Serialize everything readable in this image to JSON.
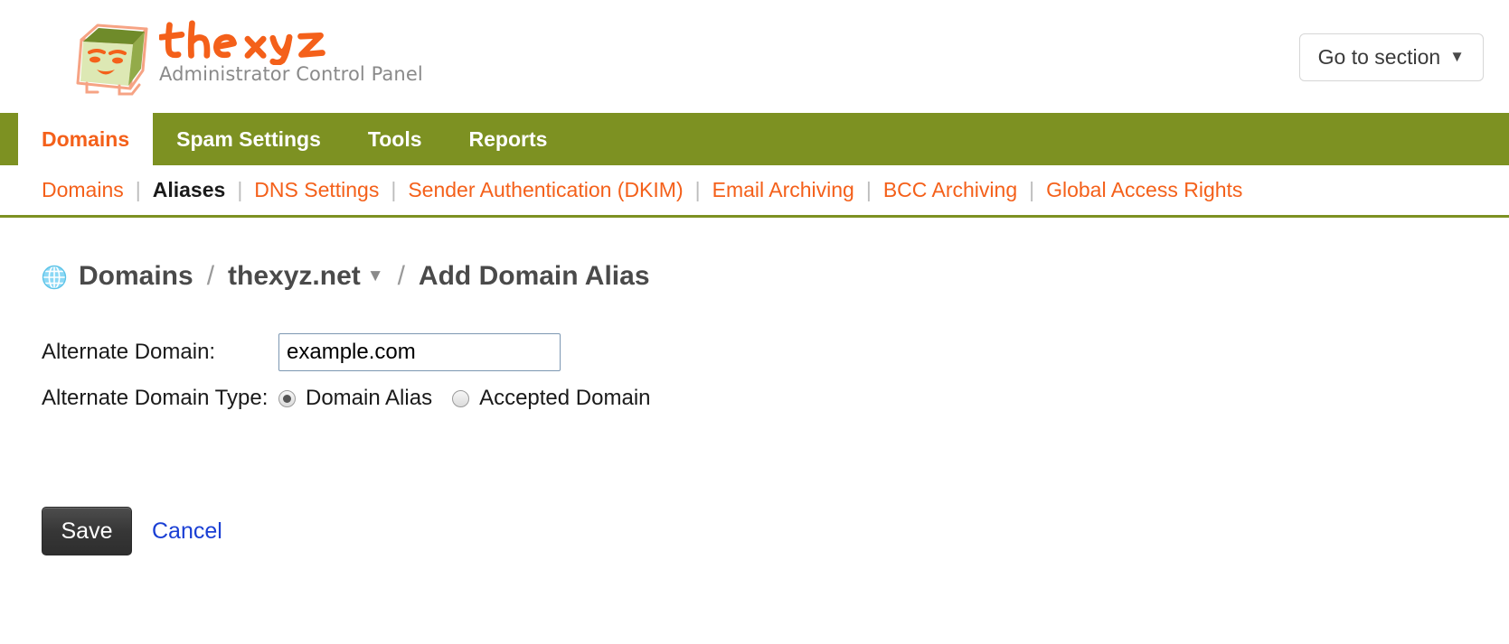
{
  "brand": {
    "wordmark": "thexyz",
    "tagline": "Administrator Control Panel",
    "logo_icon": "box-face-logo-icon",
    "colors": {
      "orange": "#f4601a",
      "olive": "#7d9122",
      "logo_face": "#dde8b4",
      "logo_top": "#6f8b2a",
      "logo_outline": "#f5a98a"
    }
  },
  "header": {
    "goto_section_label": "Go to section",
    "goto_section_icon": "chevron-down-icon"
  },
  "nav": {
    "tabs": [
      {
        "label": "Domains",
        "active": true
      },
      {
        "label": "Spam Settings",
        "active": false
      },
      {
        "label": "Tools",
        "active": false
      },
      {
        "label": "Reports",
        "active": false
      }
    ]
  },
  "subnav": {
    "separator": "|",
    "items": [
      {
        "label": "Domains",
        "current": false
      },
      {
        "label": "Aliases",
        "current": true
      },
      {
        "label": "DNS Settings",
        "current": false
      },
      {
        "label": "Sender Authentication (DKIM)",
        "current": false
      },
      {
        "label": "Email Archiving",
        "current": false
      },
      {
        "label": "BCC Archiving",
        "current": false
      },
      {
        "label": "Global Access Rights",
        "current": false
      }
    ]
  },
  "breadcrumb": {
    "icon": "globe-icon",
    "separator": "/",
    "domains_label": "Domains",
    "domain_label": "thexyz.net",
    "domain_chevron": "chevron-down-icon",
    "page_label": "Add Domain Alias"
  },
  "form": {
    "alternate_domain": {
      "label": "Alternate Domain:",
      "value": "example.com",
      "placeholder": ""
    },
    "alternate_domain_type": {
      "label": "Alternate Domain Type:",
      "options": [
        {
          "label": "Domain Alias",
          "selected": true
        },
        {
          "label": "Accepted Domain",
          "selected": false
        }
      ]
    }
  },
  "actions": {
    "save_label": "Save",
    "cancel_label": "Cancel"
  }
}
